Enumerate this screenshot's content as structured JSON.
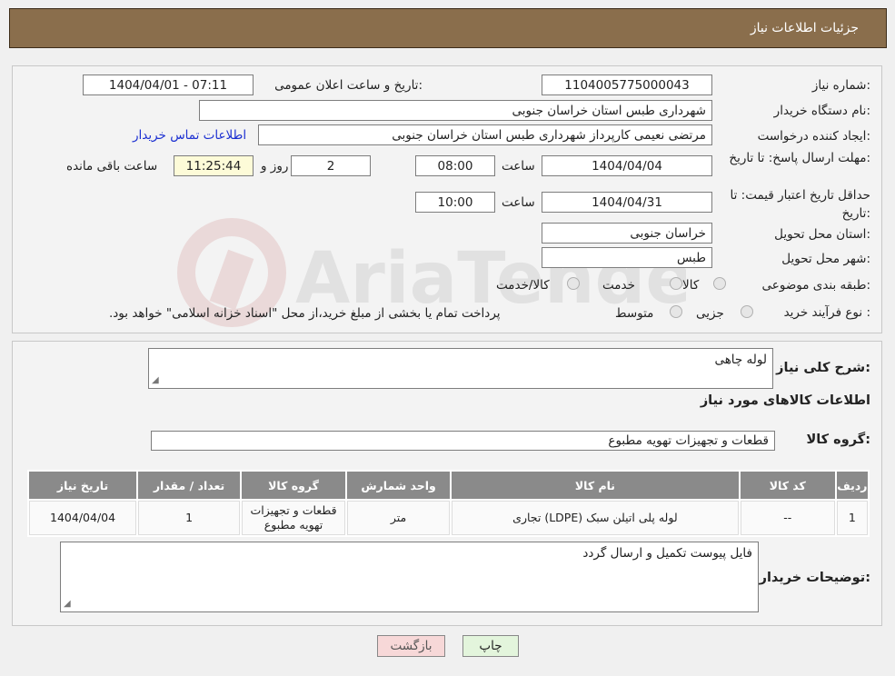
{
  "header": {
    "title": "جزئیات اطلاعات نیاز"
  },
  "watermark": {
    "text": "AriaTender.neT"
  },
  "info": {
    "need_number_label": "شماره نیاز:",
    "need_number": "1104005775000043",
    "announce_label": "تاریخ و ساعت اعلان عمومی:",
    "announce_value": "1404/04/01 - 07:11",
    "buyer_org_label": "نام دستگاه خریدار:",
    "buyer_org": "شهرداری طبس استان خراسان جنوبی",
    "requester_label": "ایجاد کننده درخواست:",
    "requester": "مرتضی نعیمی کارپرداز شهرداری طبس استان خراسان جنوبی",
    "contact_link": "اطلاعات تماس خریدار",
    "deadline_label": "مهلت ارسال پاسخ: تا تاریخ:",
    "deadline_date": "1404/04/04",
    "time_label": "ساعت",
    "deadline_time": "08:00",
    "days_value": "2",
    "days_label": "روز و",
    "remaining_time": "11:25:44",
    "remaining_label": "ساعت باقی مانده",
    "validity_label": "حداقل تاریخ اعتبار قیمت: تا تاریخ:",
    "validity_date": "1404/04/31",
    "validity_time": "10:00",
    "province_label": "استان محل تحویل:",
    "province": "خراسان جنوبی",
    "city_label": "شهر محل تحویل:",
    "city": "طبس",
    "category_label": "طبقه بندی موضوعی:",
    "category_options": [
      "کالا",
      "خدمت",
      "کالا/خدمت"
    ],
    "purchase_type_label": "نوع فرآیند خرید :",
    "purchase_options": [
      "جزیی",
      "متوسط"
    ],
    "purchase_note": "پرداخت تمام یا بخشی از مبلغ خرید،از محل \"اسناد خزانه اسلامی\" خواهد بود."
  },
  "details": {
    "summary_label": "شرح کلی نیاز:",
    "summary_value": "لوله چاهی",
    "goods_info_title": "اطلاعات کالاهای مورد نیاز",
    "goods_group_label": "گروه کالا:",
    "goods_group_value": "قطعات و تجهیزات تهویه مطبوع",
    "table": {
      "headers": [
        "ردیف",
        "کد کالا",
        "نام کالا",
        "واحد شمارش",
        "گروه کالا",
        "تعداد / مقدار",
        "تاریخ نیاز"
      ],
      "rows": [
        [
          "1",
          "--",
          "لوله پلی اتیلن سبک (LDPE) تجاری",
          "متر",
          "قطعات و تجهیزات تهویه مطبوع",
          "1",
          "1404/04/04"
        ]
      ]
    },
    "buyer_notes_label": "توضیحات خریدار:",
    "buyer_notes_value": "فایل پیوست تکمیل و ارسال گردد"
  },
  "buttons": {
    "print": "چاپ",
    "back": "بازگشت"
  },
  "colors": {
    "header": "#8a6e4c",
    "table_header": "#8a8a8a",
    "link": "#1b2fd1",
    "remaining_bg": "#fdfbd8",
    "back_bg": "#f7d8d8",
    "print_bg": "#e3f5dc"
  }
}
